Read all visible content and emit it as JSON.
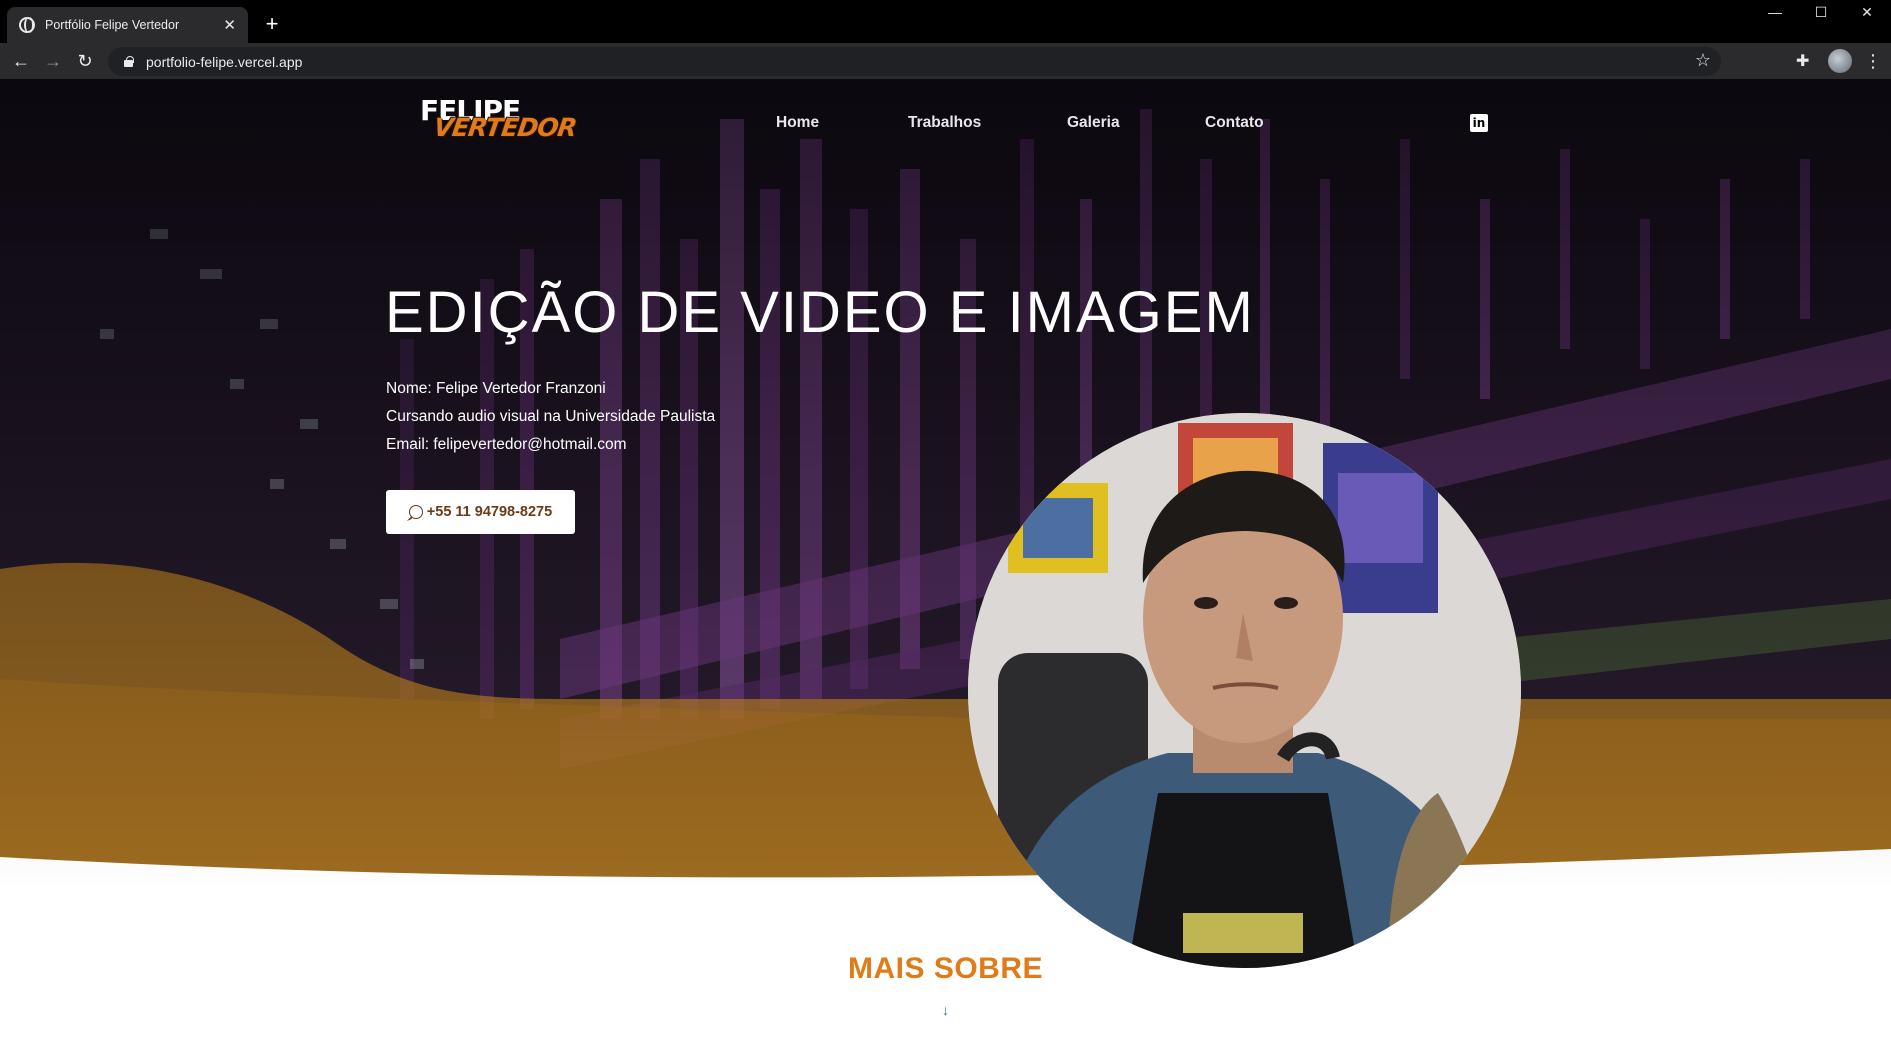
{
  "browser": {
    "tab_title": "Portfólio Felipe Vertedor",
    "tab_close": "✕",
    "new_tab": "+",
    "url": "portfolio-felipe.vercel.app",
    "window_controls": {
      "minimize": "—",
      "maximize": "☐",
      "close": "✕"
    }
  },
  "site": {
    "logo": {
      "line1": "FELIPE",
      "line2": "VERTEDOR"
    },
    "nav": [
      {
        "label": "Home"
      },
      {
        "label": "Trabalhos"
      },
      {
        "label": "Galeria"
      },
      {
        "label": "Contato"
      }
    ],
    "social_icon": "linkedin-icon",
    "social_glyph": "in",
    "hero": {
      "headline": "EDIÇÃO DE VIDEO E IMAGEM",
      "name_line": "Nome: Felipe Vertedor Franzoni",
      "course_line": "Cursando audio visual na Universidade Paulista",
      "email_line": "Email: felipevertedor@hotmail.com",
      "phone_button": "+55 11 94798-8275"
    },
    "section_title": "MAIS SOBRE",
    "arrow": "↓"
  },
  "colors": {
    "accent_orange": "#e07b19",
    "button_text": "#6b3a17",
    "arrow_blue": "#2a6fb0"
  }
}
